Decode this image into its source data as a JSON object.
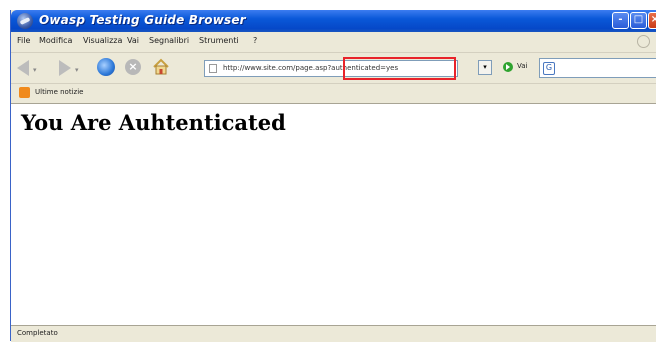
{
  "window": {
    "title": "Owasp Testing Guide Browser"
  },
  "titlebar_buttons": {
    "minimize": "-",
    "maximize": "□",
    "close": "×"
  },
  "menu": {
    "items": [
      "File",
      "Modifica",
      "Visualizza",
      "Vai",
      "Segnalibri",
      "Strumenti",
      "?"
    ]
  },
  "toolbar": {
    "url": "http://www.site.com/page.asp?authenticated=yes",
    "go_label": "Vai",
    "search_value": "",
    "icons": [
      "back-icon",
      "forward-icon",
      "reload-icon",
      "stop-icon",
      "home-icon",
      "go-icon",
      "search-icon"
    ]
  },
  "bookmarks": {
    "items": [
      "Ultime notizie"
    ]
  },
  "content": {
    "heading": "You Are Auhtenticated"
  },
  "status": {
    "text": "Completato"
  },
  "colors": {
    "titlebar": "#0a58d8",
    "highlight": "#e8232a",
    "chrome": "#ece9d8"
  }
}
